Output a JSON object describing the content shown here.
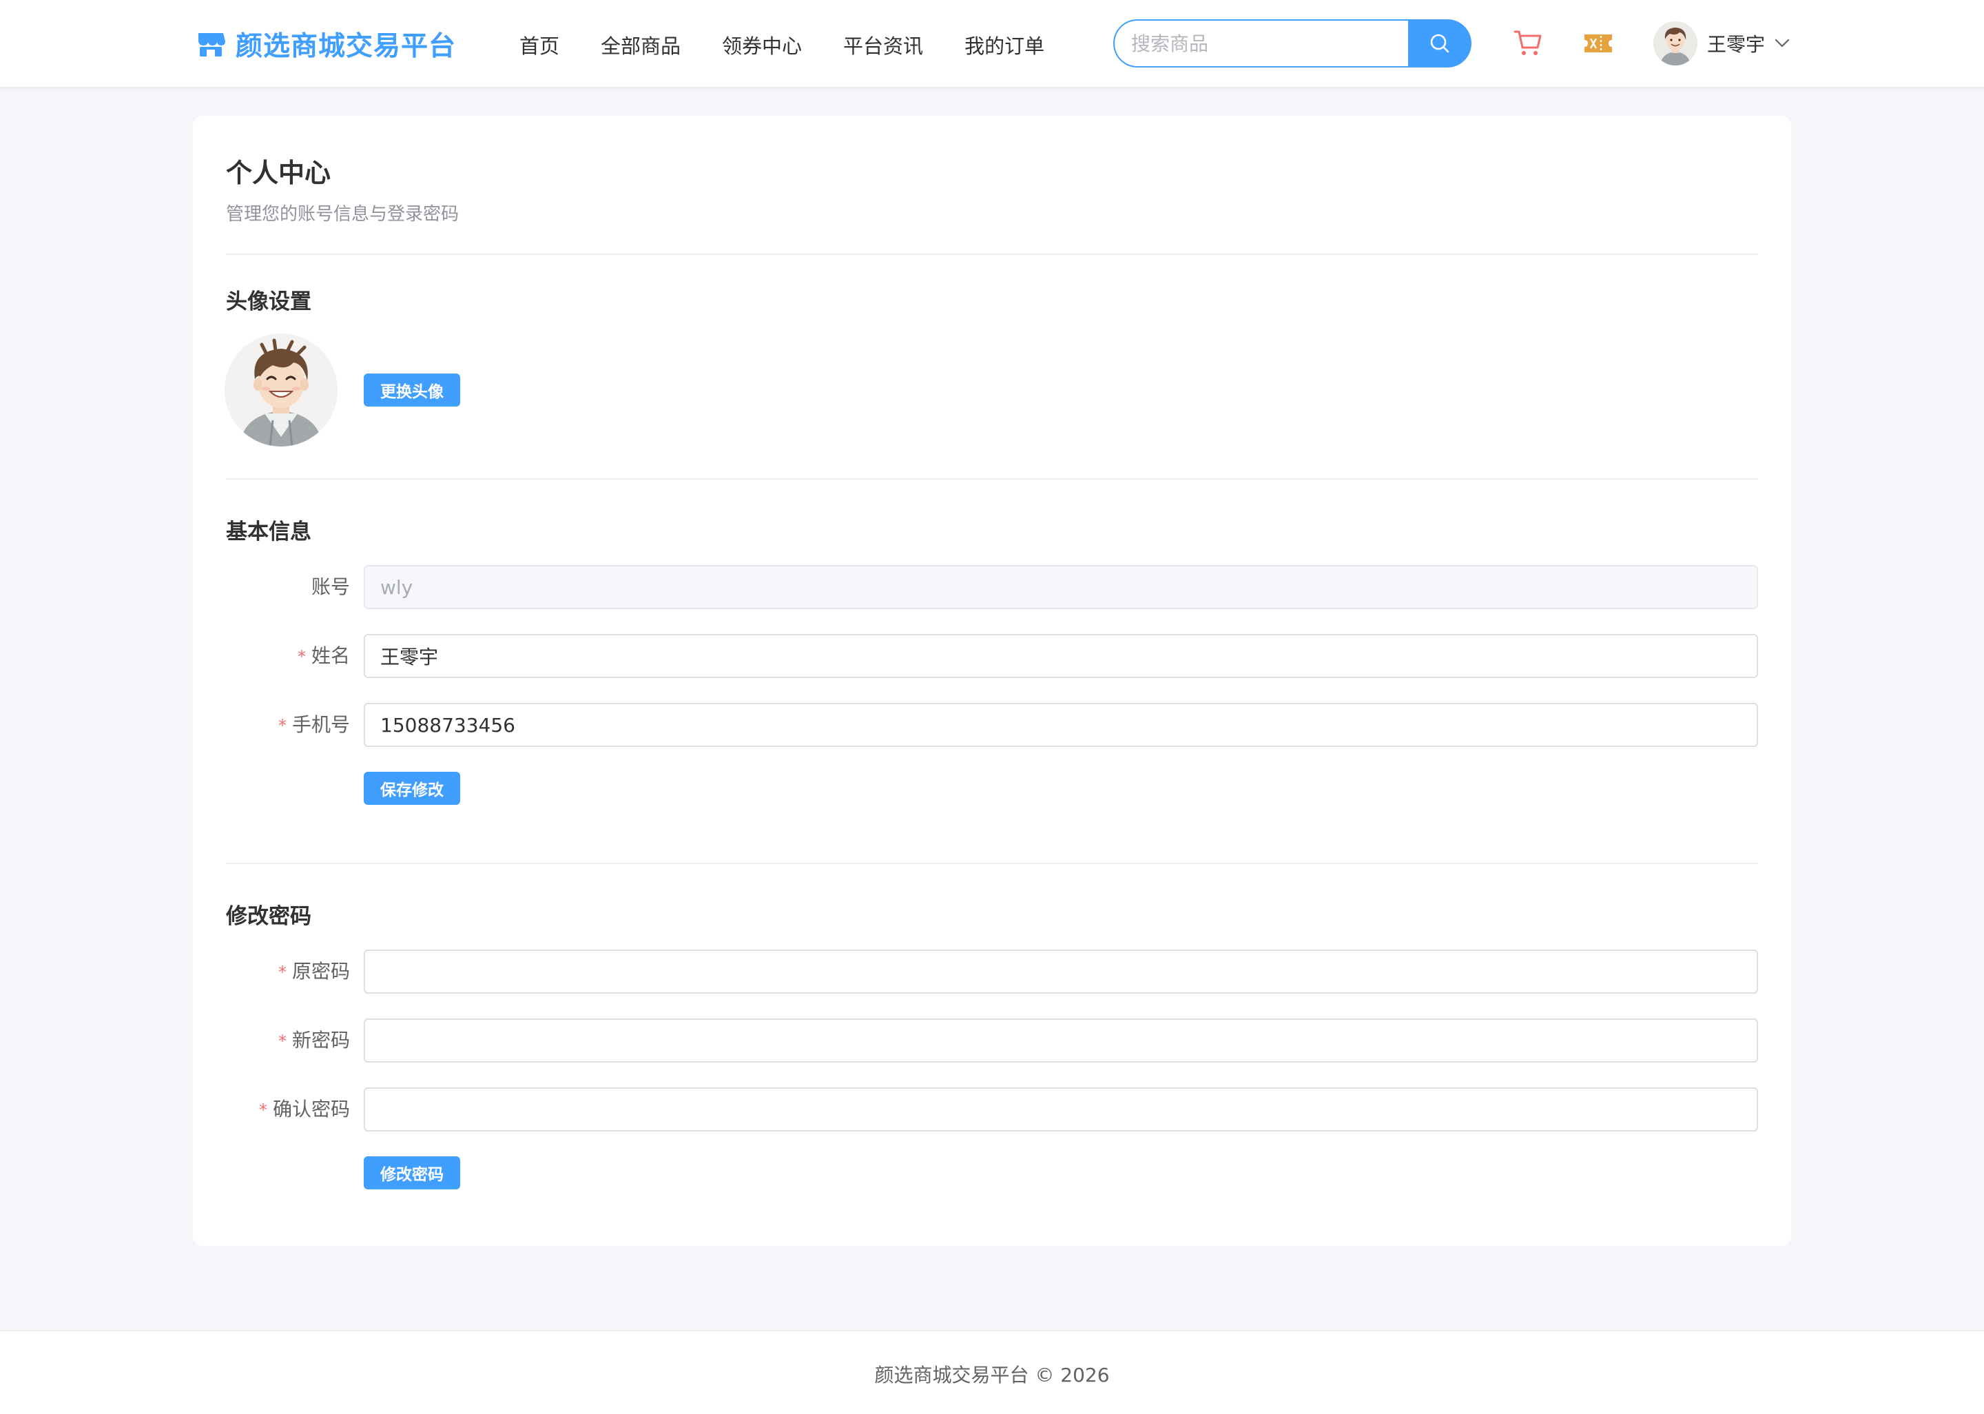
{
  "header": {
    "logo_text": "颜选商城交易平台",
    "nav": [
      "首页",
      "全部商品",
      "领券中心",
      "平台资讯",
      "我的订单"
    ],
    "search_placeholder": "搜索商品",
    "user_name": "王零宇"
  },
  "profile": {
    "title": "个人中心",
    "subtitle": "管理您的账号信息与登录密码",
    "avatar_section": {
      "title": "头像设置",
      "change_button": "更换头像"
    },
    "basic_info": {
      "title": "基本信息",
      "account_label": "账号",
      "account_value": "wly",
      "name_label": "姓名",
      "name_value": "王零宇",
      "phone_label": "手机号",
      "phone_value": "15088733456",
      "save_button": "保存修改"
    },
    "password": {
      "title": "修改密码",
      "old_label": "原密码",
      "new_label": "新密码",
      "confirm_label": "确认密码",
      "submit_button": "修改密码"
    }
  },
  "footer": {
    "text": "颜选商城交易平台 © 2026"
  },
  "colors": {
    "primary": "#409eff",
    "required": "#f56c6c",
    "cart": "#f56c6c",
    "coupon": "#e6a23c",
    "background": "#f5f6fa"
  },
  "icons": [
    "shop-logo-icon",
    "search-icon",
    "cart-icon",
    "coupon-icon",
    "chevron-down-icon"
  ]
}
